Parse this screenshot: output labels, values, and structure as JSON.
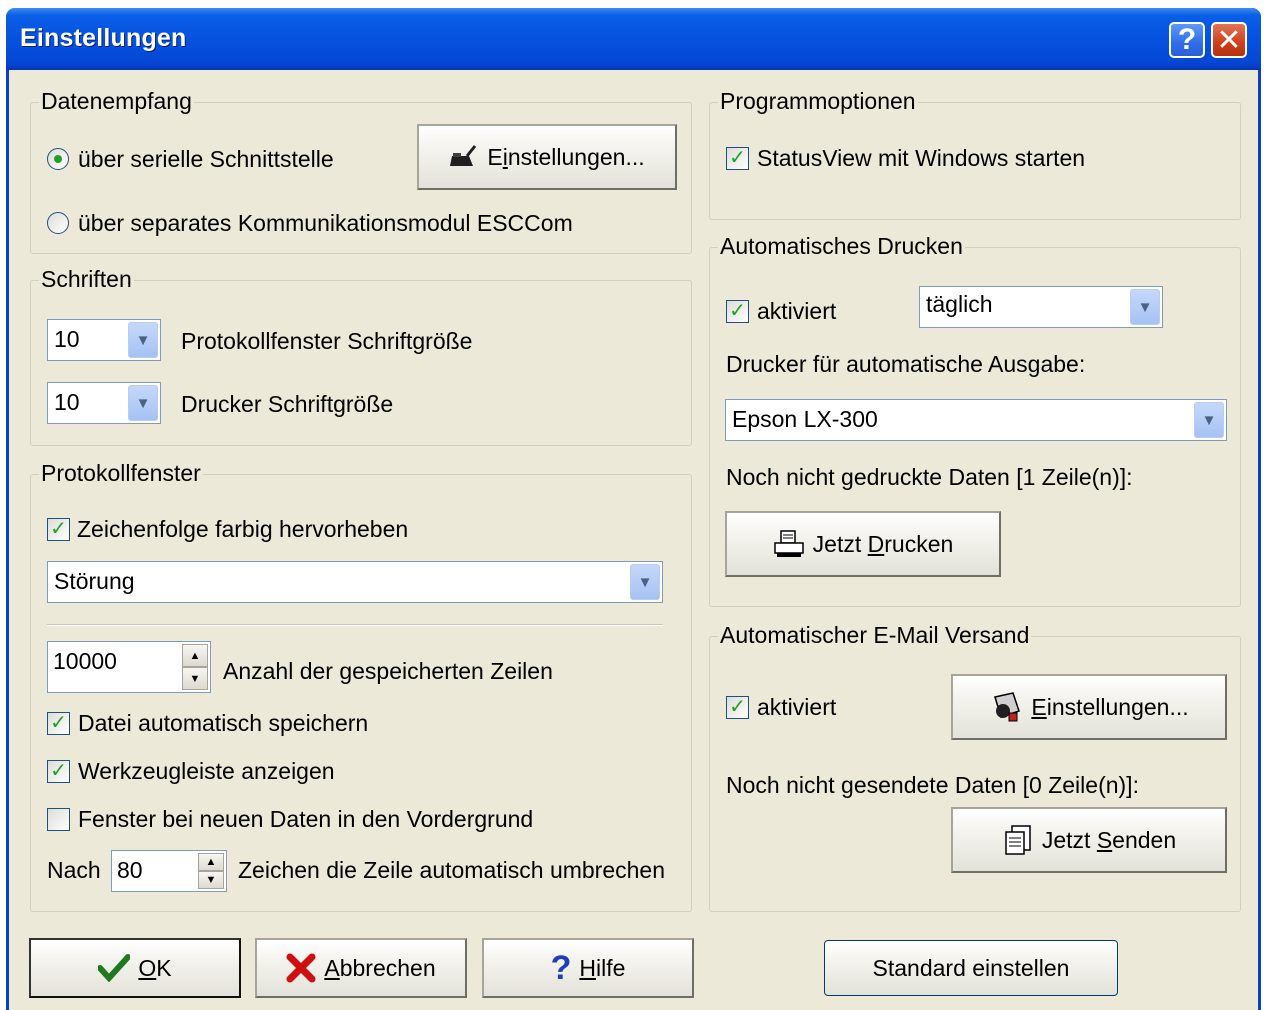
{
  "window": {
    "title": "Einstellungen",
    "help_glyph": "?",
    "close_glyph": "✕"
  },
  "datenempfang": {
    "legend": "Datenempfang",
    "radio_serial": "über serielle Schnittstelle",
    "radio_module": "über separates Kommunikationsmodul ESCCom",
    "settings_button": {
      "pre": "E",
      "accel": "i",
      "post": "nstellungen...",
      "icon": "plug-icon"
    }
  },
  "schriften": {
    "legend": "Schriften",
    "protokoll_size": "10",
    "protokoll_label": "Protokollfenster Schriftgröße",
    "drucker_size": "10",
    "drucker_label": "Drucker Schriftgröße"
  },
  "protokollfenster": {
    "legend": "Protokollfenster",
    "highlight_label": "Zeichenfolge farbig hervorheben",
    "highlight_checked": true,
    "highlight_value": "Störung",
    "lines_value": "10000",
    "lines_label": "Anzahl der gespeicherten Zeilen",
    "autosave_label": "Datei automatisch speichern",
    "toolbar_label": "Werkzeugleiste anzeigen",
    "foreground_label": "Fenster bei neuen Daten in den Vordergrund",
    "wrap_prefix": "Nach",
    "wrap_value": "80",
    "wrap_suffix": "Zeichen die Zeile automatisch umbrechen"
  },
  "programmoptionen": {
    "legend": "Programmoptionen",
    "start_with_windows": "StatusView mit Windows starten"
  },
  "drucken": {
    "legend": "Automatisches Drucken",
    "active_label": "aktiviert",
    "interval": "täglich",
    "printer_label": "Drucker für automatische Ausgabe:",
    "printer": "Epson LX-300",
    "pending": "Noch nicht gedruckte Daten [1 Zeile(n)]:",
    "print_button": {
      "pre": "Jetzt ",
      "accel": "D",
      "post": "rucken",
      "icon": "printer-icon"
    }
  },
  "email": {
    "legend": "Automatischer E-Mail Versand",
    "active_label": "aktiviert",
    "settings_button": {
      "pre": "",
      "accel": "E",
      "post": "instellungen...",
      "icon": "mail-settings-icon"
    },
    "pending": "Noch nicht gesendete Daten [0 Zeile(n)]:",
    "send_button": {
      "pre": "Jetzt ",
      "accel": "S",
      "post": "enden",
      "icon": "send-document-icon"
    }
  },
  "footer": {
    "ok": {
      "accel": "O",
      "post": "K"
    },
    "cancel": {
      "accel": "A",
      "post": "bbrechen"
    },
    "help": {
      "accel": "H",
      "post": "ilfe"
    },
    "defaults": "Standard einstellen"
  }
}
